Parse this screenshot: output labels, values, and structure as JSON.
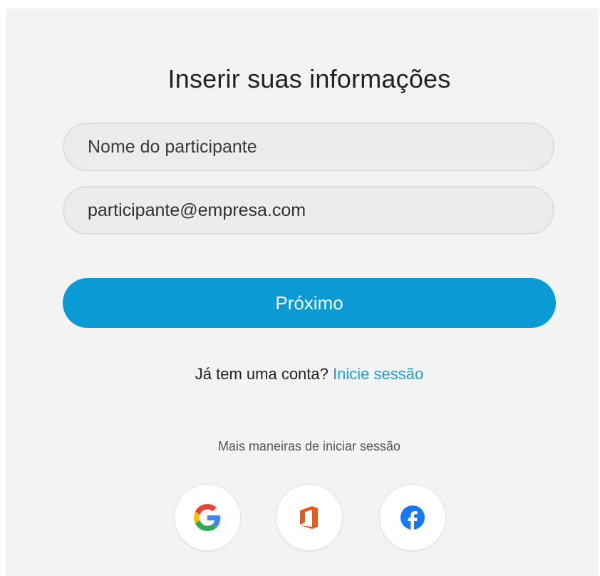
{
  "form": {
    "title": "Inserir suas informações",
    "name_placeholder": "Nome do participante",
    "email_value": "participante@empresa.com",
    "next_label": "Próximo"
  },
  "account": {
    "prompt": "Já tem uma conta?",
    "signin_link": "Inicie sessão"
  },
  "more_signin": {
    "label": "Mais maneiras de iniciar sessão",
    "providers": [
      {
        "name": "Google",
        "icon": "google-icon"
      },
      {
        "name": "Office",
        "icon": "office-icon"
      },
      {
        "name": "Facebook",
        "icon": "facebook-icon"
      }
    ]
  },
  "colors": {
    "accent": "#0a9bd4",
    "link": "#1a9fd6",
    "background": "#f3f3f3"
  }
}
